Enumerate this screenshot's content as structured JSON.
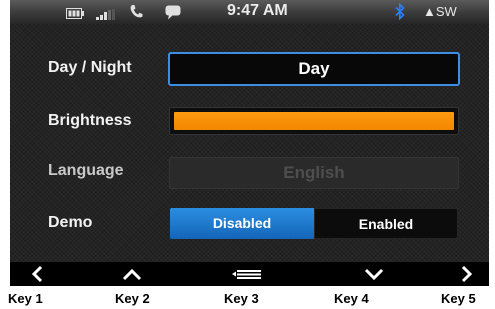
{
  "status_bar": {
    "time": "9:47 AM",
    "compass": "▲SW",
    "icons": [
      "battery-icon",
      "signal-icon",
      "phone-icon",
      "message-icon",
      "bluetooth-icon"
    ],
    "bluetooth_color": "#2a7fff"
  },
  "settings": {
    "day_night": {
      "label": "Day / Night",
      "value": "Day"
    },
    "brightness": {
      "label": "Brightness",
      "level": 1.0,
      "color": "#f28600"
    },
    "language": {
      "label": "Language",
      "value": "English",
      "enabled": false
    },
    "demo": {
      "label": "Demo",
      "options": [
        "Disabled",
        "Enabled"
      ],
      "selected": "Disabled"
    }
  },
  "accent_color": "#2b8ee0",
  "keys": [
    {
      "icon": "chevron-left-icon",
      "label": "Key 1"
    },
    {
      "icon": "chevron-up-icon",
      "label": "Key 2"
    },
    {
      "icon": "menu-icon",
      "label": "Key 3"
    },
    {
      "icon": "chevron-down-icon",
      "label": "Key 4"
    },
    {
      "icon": "chevron-right-icon",
      "label": "Key 5"
    }
  ]
}
